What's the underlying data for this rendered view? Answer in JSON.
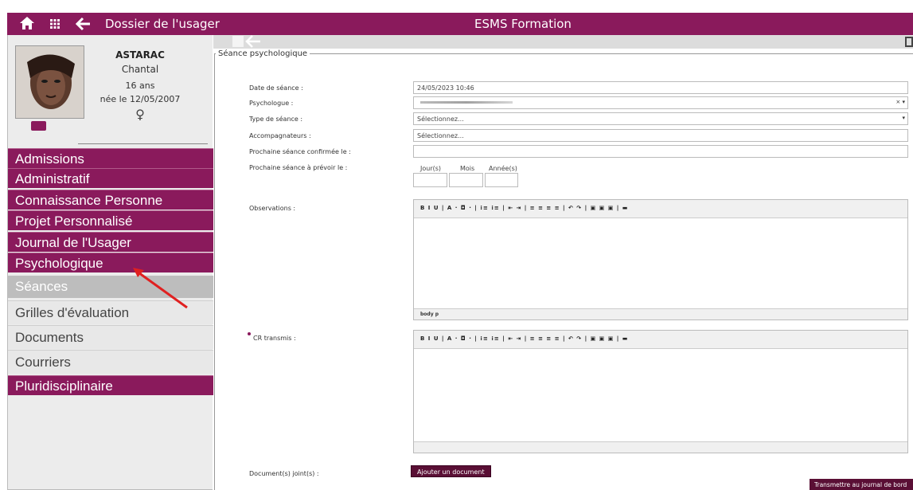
{
  "header": {
    "breadcrumb": "Dossier de l'usager",
    "app_title": "ESMS Formation"
  },
  "patient": {
    "last_name": "ASTARAC",
    "first_name": "Chantal",
    "age": "16 ans",
    "birth": "née le 12/05/2007",
    "sex_symbol": "♀"
  },
  "nav": {
    "admissions": "Admissions",
    "administratif": "Administratif",
    "connaissance": "Connaissance Personne",
    "projet": "Projet Personnalisé",
    "journal": "Journal de l'Usager",
    "psychologique": "Psychologique",
    "seances": "Séances",
    "grilles": "Grilles d'évaluation",
    "documents": "Documents",
    "courriers": "Courriers",
    "pluri": "Pluridisciplinaire"
  },
  "form": {
    "section_title": "Séance psychologique",
    "date_label": "Date de séance :",
    "date_value": "24/05/2023 10:46",
    "psy_label": "Psychologue :",
    "psy_clear": "× ▾",
    "type_label": "Type de séance :",
    "type_placeholder": "Sélectionnez...",
    "acc_label": "Accompagnateurs :",
    "acc_placeholder": "Sélectionnez...",
    "next_confirmed_label": "Prochaine séance confirmée le :",
    "next_planned_label": "Prochaine séance à prévoir le :",
    "day_label": "Jour(s)",
    "month_label": "Mois",
    "year_label": "Année(s)",
    "obs_label": "Observations :",
    "cr_label": "CR transmis :",
    "docs_label": "Document(s) joint(s) :"
  },
  "editor": {
    "toolbar": "B  I  U | A · ◘ · | ⁝≡ ⁝≡ | ⇤ ⇥ | ≡ ≡ ≡ ≡ | ↶ ↷ | ▣ ▣ ▣ | ▬",
    "status": "body  p"
  },
  "buttons": {
    "add_document": "Ajouter un document",
    "send_journal": "Transmettre au journal de bord"
  },
  "colors": {
    "primary": "#8a1a5c",
    "dark_button": "#5a0f35"
  }
}
